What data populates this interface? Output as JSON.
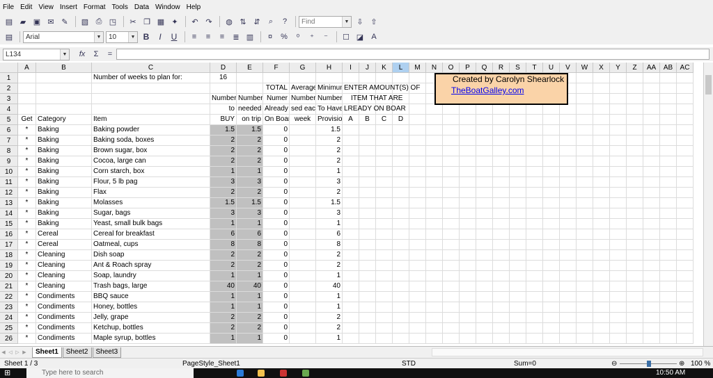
{
  "menu": [
    "File",
    "Edit",
    "View",
    "Insert",
    "Format",
    "Tools",
    "Data",
    "Window",
    "Help"
  ],
  "toolbar": {
    "find_placeholder": "Find",
    "font_name": "Arial",
    "font_size": "10",
    "bold": "B",
    "italic": "I",
    "underline": "U",
    "percent": "%"
  },
  "formula": {
    "cell_ref": "L134",
    "fx": "fx",
    "sum": "Σ",
    "equals": "="
  },
  "columns": [
    "A",
    "B",
    "C",
    "D",
    "E",
    "F",
    "G",
    "H",
    "I",
    "J",
    "K",
    "L",
    "M",
    "N",
    "O",
    "P",
    "Q",
    "R",
    "S",
    "T",
    "U",
    "V",
    "W",
    "X",
    "Y",
    "Z",
    "AA",
    "AB",
    "AC"
  ],
  "rows": [
    [
      "",
      "",
      "Number of weeks to plan for:",
      "16",
      "",
      "",
      "",
      "",
      "",
      "",
      "",
      "",
      "",
      ""
    ],
    [
      "",
      "",
      "",
      "",
      "",
      "TOTAL",
      "Average",
      "Minimum",
      "ENTER AMOUNT(S) OF",
      "",
      "",
      "",
      "",
      ""
    ],
    [
      "",
      "",
      "",
      "Number",
      "Number",
      "Numer",
      "Number",
      "Number",
      "ITEM THAT ARE",
      "",
      "",
      "",
      "",
      ""
    ],
    [
      "",
      "",
      "",
      "to",
      "needed",
      "Already",
      "sed eac",
      "To Have",
      "LREADY ON BOAR",
      "",
      "",
      "",
      "",
      ""
    ],
    [
      "Get",
      "Category",
      "Item",
      "BUY",
      "on trip",
      "On Boar",
      "week",
      "Provisio",
      "A",
      "B",
      "C",
      "D",
      "",
      ""
    ],
    [
      "*",
      "Baking",
      "Baking powder",
      "1.5",
      "1.5",
      "0",
      "",
      "1.5",
      "",
      "",
      "",
      "",
      "",
      ""
    ],
    [
      "*",
      "Baking",
      "Baking soda, boxes",
      "2",
      "2",
      "0",
      "",
      "2",
      "",
      "",
      "",
      "",
      "",
      ""
    ],
    [
      "*",
      "Baking",
      "Brown sugar, box",
      "2",
      "2",
      "0",
      "",
      "2",
      "",
      "",
      "",
      "",
      "",
      ""
    ],
    [
      "*",
      "Baking",
      "Cocoa, large can",
      "2",
      "2",
      "0",
      "",
      "2",
      "",
      "",
      "",
      "",
      "",
      ""
    ],
    [
      "*",
      "Baking",
      "Corn starch, box",
      "1",
      "1",
      "0",
      "",
      "1",
      "",
      "",
      "",
      "",
      "",
      ""
    ],
    [
      "*",
      "Baking",
      "Flour, 5 lb pag",
      "3",
      "3",
      "0",
      "",
      "3",
      "",
      "",
      "",
      "",
      "",
      ""
    ],
    [
      "*",
      "Baking",
      "Flax",
      "2",
      "2",
      "0",
      "",
      "2",
      "",
      "",
      "",
      "",
      "",
      ""
    ],
    [
      "*",
      "Baking",
      "Molasses",
      "1.5",
      "1.5",
      "0",
      "",
      "1.5",
      "",
      "",
      "",
      "",
      "",
      ""
    ],
    [
      "*",
      "Baking",
      "Sugar, bags",
      "3",
      "3",
      "0",
      "",
      "3",
      "",
      "",
      "",
      "",
      "",
      ""
    ],
    [
      "*",
      "Baking",
      "Yeast, small bulk bags",
      "1",
      "1",
      "0",
      "",
      "1",
      "",
      "",
      "",
      "",
      "",
      ""
    ],
    [
      "*",
      "Cereal",
      "Cereal for breakfast",
      "6",
      "6",
      "0",
      "",
      "6",
      "",
      "",
      "",
      "",
      "",
      ""
    ],
    [
      "*",
      "Cereal",
      "Oatmeal, cups",
      "8",
      "8",
      "0",
      "",
      "8",
      "",
      "",
      "",
      "",
      "",
      ""
    ],
    [
      "*",
      "Cleaning",
      "Dish soap",
      "2",
      "2",
      "0",
      "",
      "2",
      "",
      "",
      "",
      "",
      "",
      ""
    ],
    [
      "*",
      "Cleaning",
      "Ant & Roach spray",
      "2",
      "2",
      "0",
      "",
      "2",
      "",
      "",
      "",
      "",
      "",
      ""
    ],
    [
      "*",
      "Cleaning",
      "Soap, laundry",
      "1",
      "1",
      "0",
      "",
      "1",
      "",
      "",
      "",
      "",
      "",
      ""
    ],
    [
      "*",
      "Cleaning",
      "Trash bags, large",
      "40",
      "40",
      "0",
      "",
      "40",
      "",
      "",
      "",
      "",
      "",
      ""
    ],
    [
      "*",
      "Condiments",
      "BBQ sauce",
      "1",
      "1",
      "0",
      "",
      "1",
      "",
      "",
      "",
      "",
      "",
      ""
    ],
    [
      "*",
      "Condiments",
      "Honey, bottles",
      "1",
      "1",
      "0",
      "",
      "1",
      "",
      "",
      "",
      "",
      "",
      ""
    ],
    [
      "*",
      "Condiments",
      "Jelly, grape",
      "2",
      "2",
      "0",
      "",
      "2",
      "",
      "",
      "",
      "",
      "",
      ""
    ],
    [
      "*",
      "Condiments",
      "Ketchup, bottles",
      "2",
      "2",
      "0",
      "",
      "2",
      "",
      "",
      "",
      "",
      "",
      ""
    ],
    [
      "*",
      "Condiments",
      "Maple syrup, bottles",
      "1",
      "1",
      "0",
      "",
      "1",
      "",
      "",
      "",
      "",
      "",
      ""
    ]
  ],
  "infobox": {
    "line1": "Created by Carolyn Shearlock",
    "link": "TheBoatGalley.com"
  },
  "sheets": [
    "Sheet1",
    "Sheet2",
    "Sheet3"
  ],
  "status": {
    "sheet": "Sheet 1 / 3",
    "pagestyle": "PageStyle_Sheet1",
    "mode": "STD",
    "sum": "Sum=0",
    "zoom": "100 %",
    "zoom_level": 100
  },
  "taskbar": {
    "search": "Type here to search",
    "time": "10:50 AM"
  },
  "colors": {
    "highlight": "#fad3a8",
    "selected_header": "#aed0f0",
    "gray_cols": "#c0c0c0"
  }
}
